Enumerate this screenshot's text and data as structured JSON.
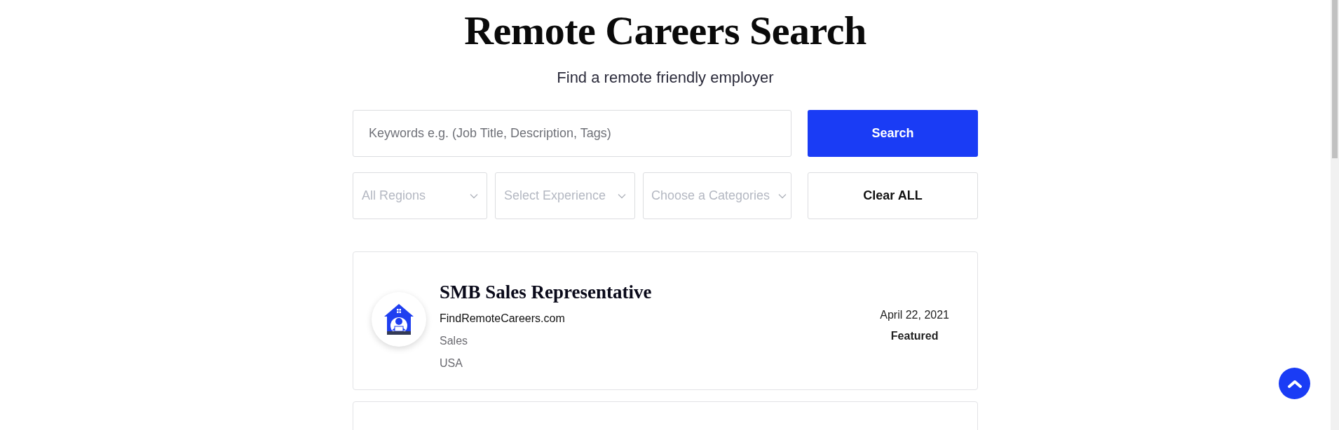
{
  "header": {
    "title": "Remote Careers Search",
    "subtitle": "Find a remote friendly employer"
  },
  "search": {
    "placeholder": "Keywords e.g. (Job Title, Description, Tags)",
    "button": "Search"
  },
  "filters": [
    {
      "placeholder": "All Regions"
    },
    {
      "placeholder": "Select Experience"
    },
    {
      "placeholder": "Choose a Categories"
    }
  ],
  "clear_button": "Clear ALL",
  "jobs": [
    {
      "title": "SMB Sales Representative",
      "company": "FindRemoteCareers.com",
      "category": "Sales",
      "location": "USA",
      "date": "April 22, 2021",
      "badge": "Featured"
    }
  ]
}
